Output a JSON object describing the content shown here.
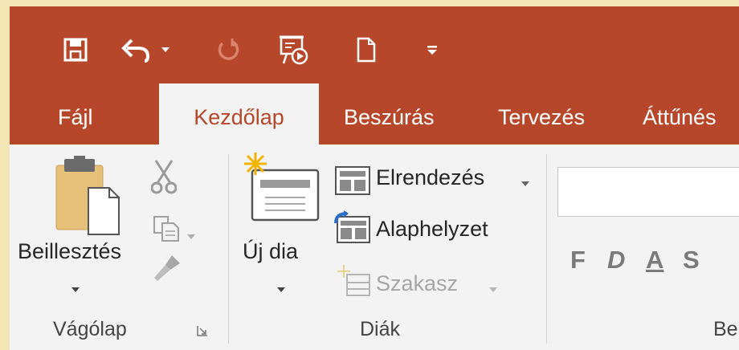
{
  "quick_access": {
    "icons": [
      "save-icon",
      "undo-icon",
      "undo-dropdown-icon",
      "redo-icon",
      "start-slideshow-icon",
      "new-document-icon",
      "customize-qat-icon"
    ]
  },
  "tabs": [
    {
      "label": "Fájl",
      "active": false
    },
    {
      "label": "Kezdőlap",
      "active": true
    },
    {
      "label": "Beszúrás",
      "active": false
    },
    {
      "label": "Tervezés",
      "active": false
    },
    {
      "label": "Áttűnés",
      "active": false
    }
  ],
  "clipboard": {
    "paste_label": "Beillesztés",
    "group_label": "Vágólap"
  },
  "slides": {
    "new_slide_label": "Új dia",
    "layout_label": "Elrendezés",
    "reset_label": "Alaphelyzet",
    "section_label": "Szakasz",
    "group_label": "Diák"
  },
  "font": {
    "bold": "F",
    "italic": "D",
    "underline": "A",
    "strike": "S",
    "group_label": "Be"
  },
  "colors": {
    "accent": "#b7472a",
    "ribbon_bg": "#f3f3f3",
    "outer_bg": "#f3e6b4"
  }
}
